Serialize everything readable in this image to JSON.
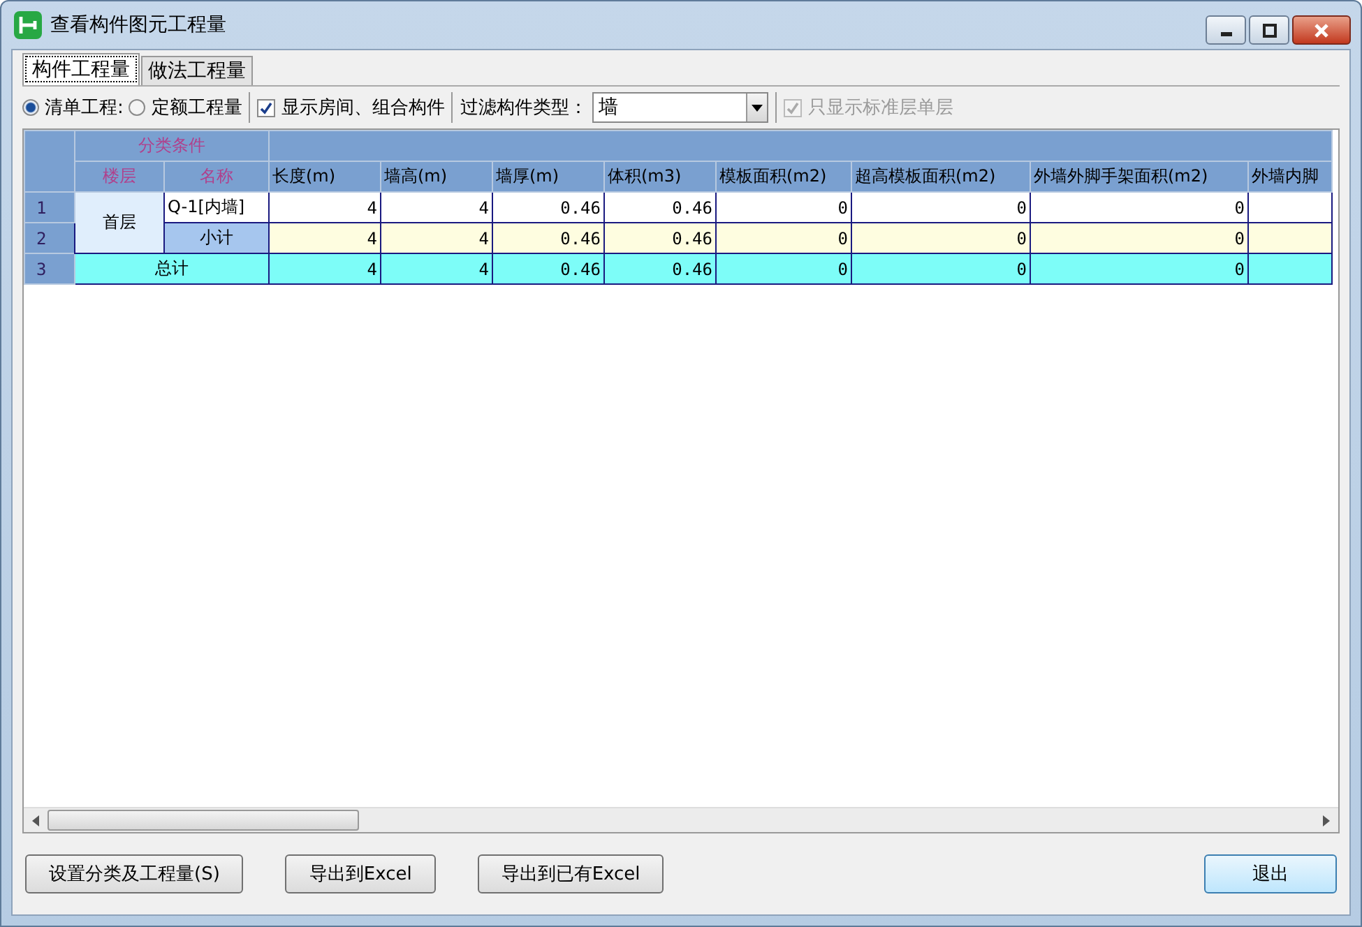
{
  "window": {
    "title": "查看构件图元工程量"
  },
  "tabs": [
    {
      "label": "构件工程量",
      "selected": true
    },
    {
      "label": "做法工程量",
      "selected": false
    }
  ],
  "options": {
    "mode_radios": [
      {
        "label": "清单工程:",
        "selected": true
      },
      {
        "label": "定额工程量",
        "selected": false
      }
    ],
    "show_rooms": {
      "label": "显示房间、组合构件",
      "checked": true
    },
    "filter": {
      "label": "过滤构件类型：",
      "value": "墙"
    },
    "standard_only": {
      "label": "只显示标准层单层",
      "checked": true,
      "disabled": true
    }
  },
  "table": {
    "group_header": "分类条件",
    "columns": [
      "楼层",
      "名称",
      "长度(m)",
      "墙高(m)",
      "墙厚(m)",
      "体积(m3)",
      "模板面积(m2)",
      "超高模板面积(m2)",
      "外墙外脚手架面积(m2)",
      "外墙内脚"
    ],
    "rows": [
      {
        "number": "1",
        "kind": "item",
        "floor": "首层",
        "name": "Q-1[内墙]",
        "values": [
          "4",
          "4",
          "0.46",
          "0.46",
          "0",
          "0",
          "0"
        ]
      },
      {
        "number": "2",
        "kind": "subtotal",
        "name": "小计",
        "values": [
          "4",
          "4",
          "0.46",
          "0.46",
          "0",
          "0",
          "0"
        ]
      },
      {
        "number": "3",
        "kind": "total",
        "name": "总计",
        "values": [
          "4",
          "4",
          "0.46",
          "0.46",
          "0",
          "0",
          "0"
        ]
      }
    ]
  },
  "buttons": [
    "设置分类及工程量(S)",
    "导出到Excel",
    "导出到已有Excel"
  ],
  "exit_button": "退出"
}
